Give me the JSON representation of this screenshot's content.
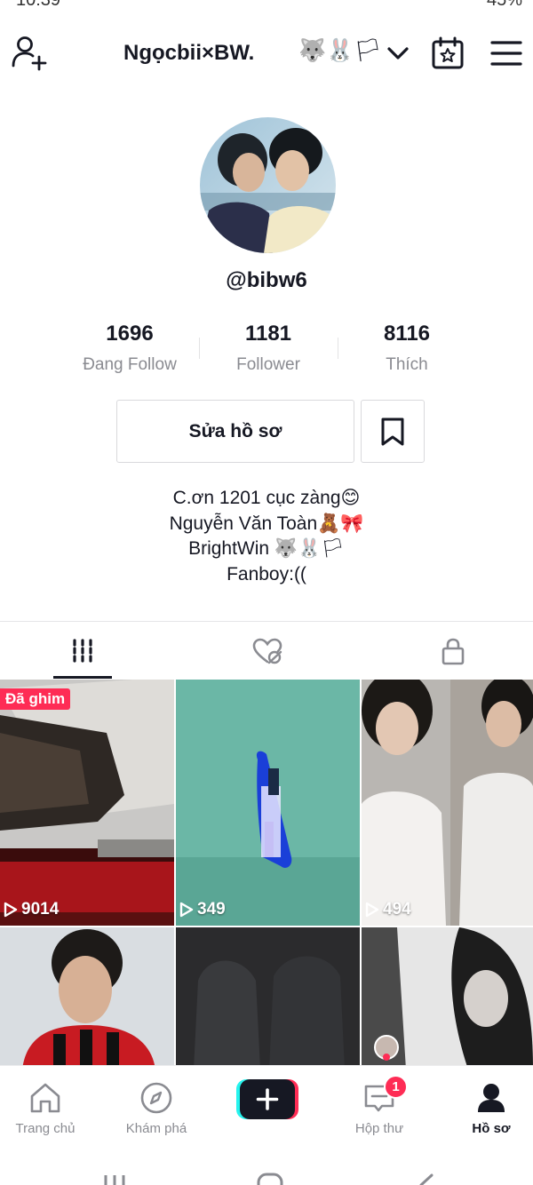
{
  "status_bar": {
    "time": "10:39",
    "battery": "45%"
  },
  "header": {
    "username": "Ngọcbii×BW.",
    "emojis": "🐺🐰🏳"
  },
  "profile": {
    "handle": "@bibw6",
    "stats": [
      {
        "value": "1696",
        "label": "Đang Follow"
      },
      {
        "value": "1181",
        "label": "Follower"
      },
      {
        "value": "8116",
        "label": "Thích"
      }
    ],
    "edit_button": "Sửa hồ sơ",
    "bio": [
      "C.ơn 1201 cục zàng😊",
      "Nguyễn Văn Toàn🧸🎀",
      "BrightWin 🐺🐰🏳",
      "Fanboy:(("
    ]
  },
  "videos": [
    {
      "views": "9014",
      "pinned_label": "Đã ghim"
    },
    {
      "views": "349"
    },
    {
      "views": "494"
    },
    {
      "views": ""
    },
    {
      "views": ""
    },
    {
      "views": ""
    }
  ],
  "bottom_nav": {
    "items": [
      {
        "label": "Trang chủ"
      },
      {
        "label": "Khám phá"
      },
      {
        "label": "Hộp thư",
        "badge": "1"
      },
      {
        "label": "Hồ sơ"
      }
    ]
  },
  "colors": {
    "accent": "#fe2c55",
    "text": "#161823",
    "muted": "#8a8b91",
    "cyan": "#25f4ee"
  }
}
